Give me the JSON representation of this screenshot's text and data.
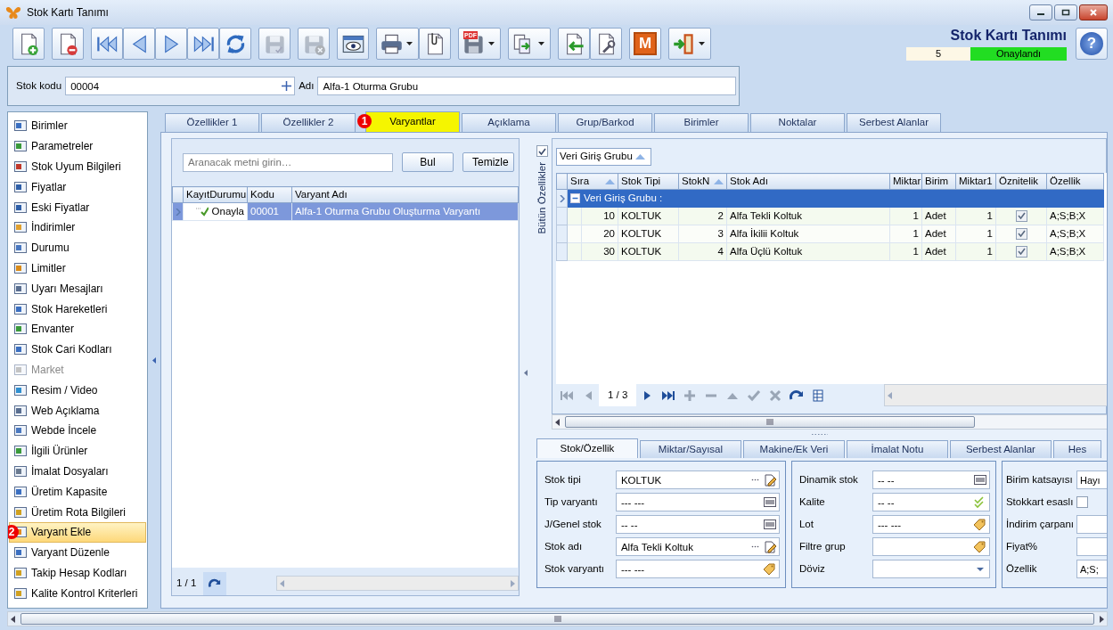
{
  "window": {
    "title": "Stok Kartı Tanımı"
  },
  "toolbar": {
    "groups": [
      {
        "buttons": [
          {
            "kind": "new",
            "disabled": false
          }
        ]
      },
      {
        "buttons": [
          {
            "kind": "delete",
            "disabled": false
          }
        ]
      },
      {
        "buttons": [
          {
            "kind": "first",
            "disabled": false
          },
          {
            "kind": "prev",
            "disabled": false
          },
          {
            "kind": "next",
            "disabled": false
          },
          {
            "kind": "last",
            "disabled": false
          },
          {
            "kind": "refresh",
            "disabled": false
          }
        ]
      },
      {
        "buttons": [
          {
            "kind": "save",
            "disabled": true
          }
        ]
      },
      {
        "buttons": [
          {
            "kind": "savex",
            "disabled": true
          }
        ]
      },
      {
        "buttons": [
          {
            "kind": "preview",
            "disabled": false
          }
        ]
      },
      {
        "buttons": [
          {
            "kind": "print",
            "disabled": false,
            "dropdown": true
          },
          {
            "kind": "attach",
            "disabled": false
          }
        ]
      },
      {
        "buttons": [
          {
            "kind": "pdf",
            "label": "PDF",
            "disabled": false,
            "dropdown": true
          }
        ]
      },
      {
        "buttons": [
          {
            "kind": "export",
            "disabled": false,
            "dropdown": true
          }
        ]
      },
      {
        "buttons": [
          {
            "kind": "import",
            "disabled": false
          },
          {
            "kind": "tools",
            "disabled": false
          }
        ]
      },
      {
        "buttons": [
          {
            "kind": "m",
            "label": "M",
            "disabled": false
          }
        ]
      },
      {
        "buttons": [
          {
            "kind": "exit",
            "disabled": false,
            "dropdown": true
          }
        ]
      }
    ]
  },
  "form_header": {
    "title": "Stok Kartı Tanımı",
    "record_no": "5",
    "status": "Onaylandı",
    "help": "?"
  },
  "stock_code": {
    "label": "Stok kodu",
    "value": "00004"
  },
  "stock_name": {
    "label": "Adı",
    "value": "Alfa-1 Oturma Grubu"
  },
  "sidebar": {
    "items": [
      {
        "label": "Birimler",
        "selected": false,
        "disabled": false
      },
      {
        "label": "Parametreler",
        "selected": false,
        "disabled": false
      },
      {
        "label": "Stok Uyum Bilgileri",
        "selected": false,
        "disabled": false
      },
      {
        "label": "Fiyatlar",
        "selected": false,
        "disabled": false
      },
      {
        "label": "Eski Fiyatlar",
        "selected": false,
        "disabled": false
      },
      {
        "label": "İndirimler",
        "selected": false,
        "disabled": false
      },
      {
        "label": "Durumu",
        "selected": false,
        "disabled": false
      },
      {
        "label": "Limitler",
        "selected": false,
        "disabled": false
      },
      {
        "label": "Uyarı Mesajları",
        "selected": false,
        "disabled": false
      },
      {
        "label": "Stok Hareketleri",
        "selected": false,
        "disabled": false
      },
      {
        "label": "Envanter",
        "selected": false,
        "disabled": false
      },
      {
        "label": "Stok Cari Kodları",
        "selected": false,
        "disabled": false
      },
      {
        "label": "Market",
        "selected": false,
        "disabled": true
      },
      {
        "label": "Resim / Video",
        "selected": false,
        "disabled": false
      },
      {
        "label": "Web Açıklama",
        "selected": false,
        "disabled": false
      },
      {
        "label": "Webde İncele",
        "selected": false,
        "disabled": false
      },
      {
        "label": "İlgili Ürünler",
        "selected": false,
        "disabled": false
      },
      {
        "label": "İmalat Dosyaları",
        "selected": false,
        "disabled": false
      },
      {
        "label": "Üretim Kapasite",
        "selected": false,
        "disabled": false
      },
      {
        "label": "Üretim Rota Bilgileri",
        "selected": false,
        "disabled": false
      },
      {
        "label": "Varyant Ekle",
        "selected": true,
        "disabled": false,
        "badge": "2"
      },
      {
        "label": "Varyant Düzenle",
        "selected": false,
        "disabled": false
      },
      {
        "label": "Takip Hesap Kodları",
        "selected": false,
        "disabled": false
      },
      {
        "label": "Kalite Kontrol Kriterleri",
        "selected": false,
        "disabled": false
      }
    ]
  },
  "tabs": [
    {
      "label": "Özellikler 1",
      "selected": false
    },
    {
      "label": "Özellikler 2",
      "selected": false
    },
    {
      "label": "Varyantlar",
      "selected": true,
      "badge": "1"
    },
    {
      "label": "Açıklama",
      "selected": false
    },
    {
      "label": "Grup/Barkod",
      "selected": false
    },
    {
      "label": "Birimler",
      "selected": false
    },
    {
      "label": "Noktalar",
      "selected": false
    },
    {
      "label": "Serbest Alanlar",
      "selected": false
    }
  ],
  "variants": {
    "search": {
      "placeholder": "Aranacak metni girin…"
    },
    "buttons": [
      "Bul",
      "Temizle"
    ],
    "table": {
      "columns": [
        "KayıtDurumu",
        "Kodu",
        "Varyant Adı"
      ],
      "rows": [
        {
          "cells": [
            "Onayla",
            "00001",
            "Alfa-1 Oturma Grubu Oluşturma Varyantı"
          ],
          "selected": true
        }
      ]
    },
    "pager": "1 / 1"
  },
  "features": {
    "side_label": "Bütün Özellikler",
    "all_checked": true,
    "group_by": {
      "label": "Veri Giriş Grubu",
      "sorted": true
    },
    "table": {
      "columns": [
        {
          "label": "Sıra",
          "sorted": true
        },
        {
          "label": "Stok Tipi",
          "sorted": false
        },
        {
          "label": "StokN",
          "sorted": true
        },
        {
          "label": "Stok Adı",
          "sorted": false
        },
        {
          "label": "Miktar",
          "sorted": false
        },
        {
          "label": "Birim",
          "sorted": false
        },
        {
          "label": "Miktar1",
          "sorted": false
        },
        {
          "label": "Öznitelik",
          "sorted": false
        },
        {
          "label": "Özellik",
          "sorted": false
        }
      ],
      "group_row": "Veri Giriş Grubu :",
      "group_expanded": true,
      "rows": [
        {
          "cells": [
            "10",
            "KOLTUK",
            "2",
            "Alfa Tekli Koltuk",
            "1",
            "Adet",
            "1"
          ],
          "attribute": true,
          "feature": "A;S;B;X"
        },
        {
          "cells": [
            "20",
            "KOLTUK",
            "3",
            "Alfa İkilii Koltuk",
            "1",
            "Adet",
            "1"
          ],
          "attribute": true,
          "feature": "A;S;B;X"
        },
        {
          "cells": [
            "30",
            "KOLTUK",
            "4",
            "Alfa Üçlü Koltuk",
            "1",
            "Adet",
            "1"
          ],
          "attribute": true,
          "feature": "A;S;B;X"
        }
      ]
    },
    "navigator": {
      "buttons_before": [
        {
          "kind": "first",
          "disabled": true
        },
        {
          "kind": "prev",
          "disabled": true
        }
      ],
      "counter": "1 / 3",
      "buttons_after": [
        {
          "kind": "next",
          "disabled": false
        },
        {
          "kind": "last",
          "disabled": false
        },
        {
          "kind": "add",
          "disabled": true
        },
        {
          "kind": "remove",
          "disabled": true
        },
        {
          "kind": "up",
          "disabled": true
        },
        {
          "kind": "apply",
          "disabled": true
        },
        {
          "kind": "cancel",
          "disabled": true
        },
        {
          "kind": "refresh",
          "disabled": false
        },
        {
          "kind": "grid",
          "disabled": false
        }
      ]
    }
  },
  "detail_tabs": [
    {
      "label": "Stok/Özellik",
      "selected": true
    },
    {
      "label": "Miktar/Sayısal",
      "selected": false
    },
    {
      "label": "Makine/Ek Veri",
      "selected": false
    },
    {
      "label": "İmalat Notu",
      "selected": false
    },
    {
      "label": "Serbest Alanlar",
      "selected": false
    },
    {
      "label": "Hes",
      "selected": false
    }
  ],
  "detail_groups": [
    {
      "fields": [
        {
          "label": "Stok tipi",
          "value": "KOLTUK",
          "kind": "lookup"
        },
        {
          "label": "Tip varyantı",
          "value": "--- ---",
          "kind": "barcode"
        },
        {
          "label": "J/Genel stok",
          "value": "-- --",
          "kind": "barcode"
        },
        {
          "label": "Stok adı",
          "value": "Alfa Tekli Koltuk",
          "kind": "lookup"
        },
        {
          "label": "Stok varyantı",
          "value": "--- ---",
          "kind": "tag"
        }
      ]
    },
    {
      "fields": [
        {
          "label": "Dinamik stok",
          "value": "-- --",
          "kind": "barcode"
        },
        {
          "label": "Kalite",
          "value": "-- --",
          "kind": "check"
        },
        {
          "label": "Lot",
          "value": "--- ---",
          "kind": "tag"
        },
        {
          "label": "Filtre grup",
          "kind": "tag"
        },
        {
          "label": "Döviz",
          "kind": "dropdown"
        }
      ]
    },
    {
      "fields": [
        {
          "label": "Birim katsayısı",
          "value": "Hayı",
          "kind": "text"
        },
        {
          "label": "Stokkart esaslı",
          "kind": "checkbox",
          "checked": false
        },
        {
          "label": "İndirim çarpanı",
          "kind": "text"
        },
        {
          "label": "Fiyat%",
          "kind": "text"
        },
        {
          "label": "Özellik",
          "value": "A;S;",
          "kind": "text"
        }
      ]
    }
  ]
}
